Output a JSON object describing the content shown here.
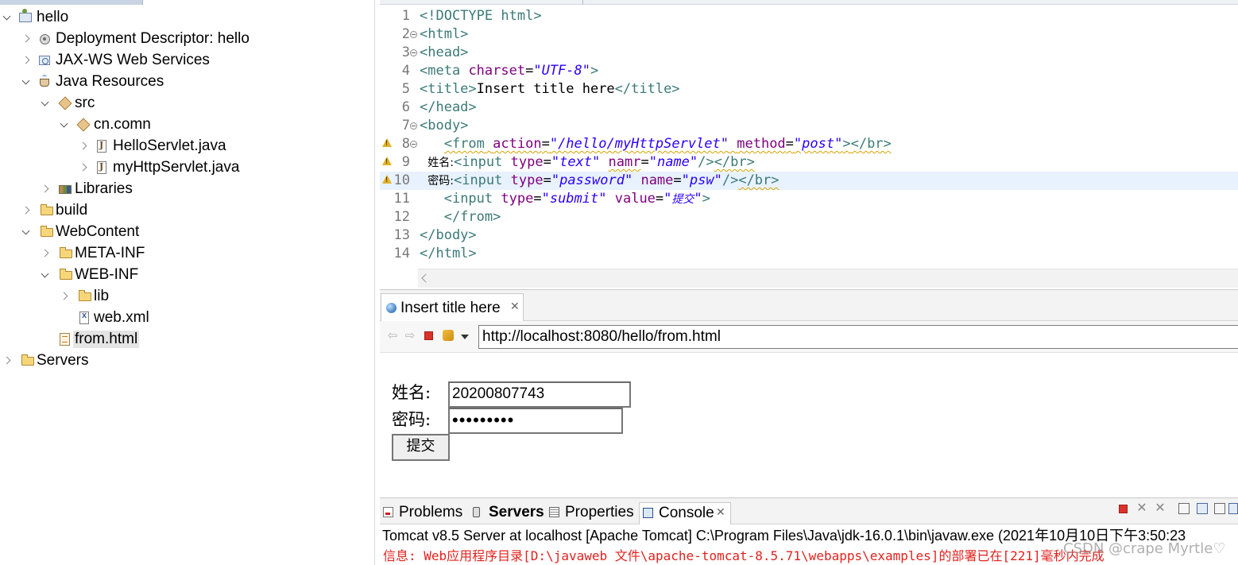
{
  "project_tree": {
    "items": [
      {
        "label": "hello",
        "expanded": true,
        "icon": "web-project-icon"
      },
      {
        "label": "Deployment Descriptor: hello",
        "expanded": false,
        "icon": "deployment-descriptor-icon"
      },
      {
        "label": "JAX-WS Web Services",
        "expanded": false,
        "icon": "jaxws-icon"
      },
      {
        "label": "Java Resources",
        "expanded": true,
        "icon": "java-resources-icon"
      },
      {
        "label": "src",
        "expanded": true,
        "icon": "source-folder-icon"
      },
      {
        "label": "cn.comn",
        "expanded": true,
        "icon": "package-icon"
      },
      {
        "label": "HelloServlet.java",
        "expanded": false,
        "icon": "java-file-icon"
      },
      {
        "label": "myHttpServlet.java",
        "expanded": false,
        "icon": "java-file-icon"
      },
      {
        "label": "Libraries",
        "expanded": false,
        "icon": "libraries-icon"
      },
      {
        "label": "build",
        "expanded": false,
        "icon": "folder-icon"
      },
      {
        "label": "WebContent",
        "expanded": true,
        "icon": "folder-icon"
      },
      {
        "label": "META-INF",
        "expanded": false,
        "icon": "folder-icon"
      },
      {
        "label": "WEB-INF",
        "expanded": true,
        "icon": "folder-icon"
      },
      {
        "label": "lib",
        "expanded": false,
        "icon": "folder-icon"
      },
      {
        "label": "web.xml",
        "expanded": null,
        "icon": "xml-file-icon"
      },
      {
        "label": "from.html",
        "expanded": null,
        "icon": "html-file-icon",
        "selected": true
      },
      {
        "label": "Servers",
        "expanded": false,
        "icon": "folder-icon"
      }
    ]
  },
  "editor": {
    "lines": [
      {
        "no": "1",
        "text": "<!DOCTYPE html>"
      },
      {
        "no": "2",
        "text": "<html>"
      },
      {
        "no": "3",
        "text": "<head>"
      },
      {
        "no": "4",
        "text": "<meta charset=\"UTF-8\">"
      },
      {
        "no": "5",
        "text": "<title>Insert title here</title>"
      },
      {
        "no": "6",
        "text": "</head>"
      },
      {
        "no": "7",
        "text": "<body>"
      },
      {
        "no": "8",
        "text": "<from action=\"/hello/myHttpServlet\" method=\"post\"></br>"
      },
      {
        "no": "9",
        "text": "姓名:<input type=\"text\" namr=\"name\"/></br>"
      },
      {
        "no": "10",
        "text": "密码:<input type=\"password\" name=\"psw\"/></br>"
      },
      {
        "no": "11",
        "text": "<input type=\"submit\" value=\"提交\">"
      },
      {
        "no": "12",
        "text": "</from>"
      },
      {
        "no": "13",
        "text": "</body>"
      },
      {
        "no": "14",
        "text": "</html>"
      }
    ]
  },
  "browser": {
    "tab_title": "Insert title here",
    "url": "http://localhost:8080/hello/from.html",
    "form": {
      "name_label": "姓名:",
      "name_value": "20200807743",
      "password_label": "密码:",
      "password_value": "•••••••••",
      "submit_label": "提交"
    }
  },
  "console": {
    "tabs": [
      {
        "label": "Problems",
        "icon": "problems-icon"
      },
      {
        "label": "Servers",
        "icon": "servers-icon"
      },
      {
        "label": "Properties",
        "icon": "properties-icon"
      },
      {
        "label": "Console",
        "icon": "console-icon"
      }
    ],
    "header": "Tomcat v8.5 Server at localhost [Apache Tomcat] C:\\Program Files\\Java\\jdk-16.0.1\\bin\\javaw.exe  (2021年10月10日下午3:50:23",
    "log_line": "信息: Web应用程序目录[D:\\javaweb 文件\\apache-tomcat-8.5.71\\webapps\\examples]的部署已在[221]毫秒内完成"
  },
  "watermark": "CSDN @crape Myrtle♡"
}
